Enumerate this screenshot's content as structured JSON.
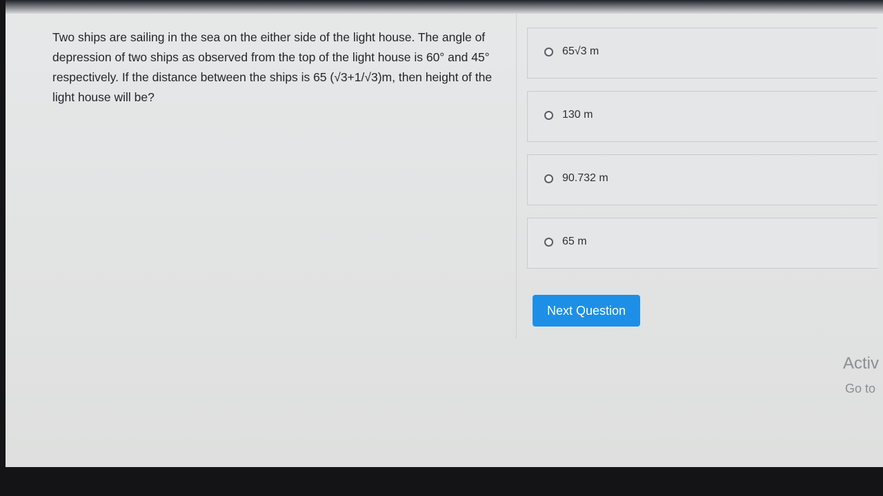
{
  "question": {
    "text": "Two ships are sailing in the sea on the either side of the light house. The angle of depression of two ships as observed from the top of the light house is 60° and 45° respectively. If the distance between the ships is 65 (√3+1/√3)m, then height of the light house will be?"
  },
  "options": [
    {
      "label": "65√3 m"
    },
    {
      "label": "130 m"
    },
    {
      "label": "90.732 m"
    },
    {
      "label": "65 m"
    }
  ],
  "next_button": {
    "label": "Next Question"
  },
  "watermark": {
    "title": "Activ",
    "subtitle": "Go to"
  },
  "colors": {
    "accent": "#1d8fe6",
    "background": "#e4e5e6"
  }
}
